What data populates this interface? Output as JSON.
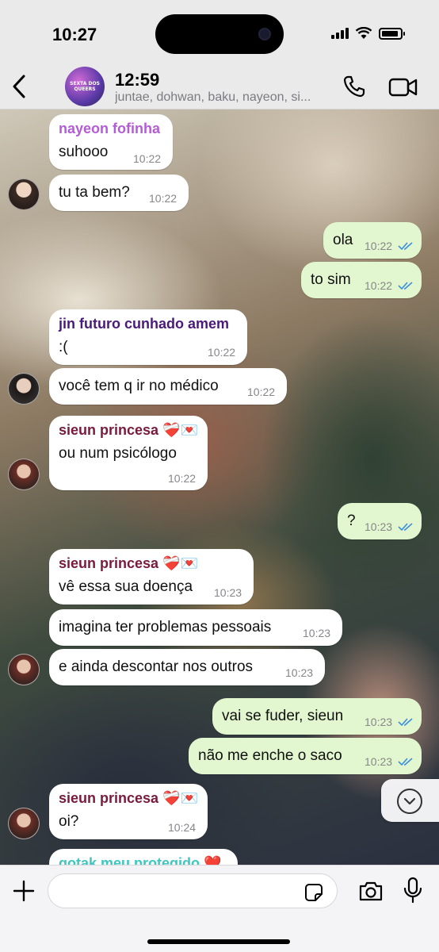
{
  "status_bar": {
    "time": "10:27",
    "battery_level": 0.9
  },
  "header": {
    "avatar_text": "SEXTA DOS QUEERS",
    "title": "12:59",
    "subtitle": "juntae, dohwan, baku, nayeon, si..."
  },
  "colors": {
    "incoming": "#ffffff",
    "outgoing": "#e2f6cf",
    "read_ticks": "#3b8fe0",
    "nayeon": "#b45cd8",
    "jin": "#4a1a7a",
    "sieun": "#7a1a3c",
    "gotak": "#3ec6c0"
  },
  "messages": [
    {
      "dir": "in",
      "sender": "nayeon fofinha",
      "text": "suhooo",
      "time": "10:22"
    },
    {
      "dir": "in",
      "text": "tu ta bem?",
      "time": "10:22"
    },
    {
      "dir": "out",
      "text": "ola",
      "time": "10:22"
    },
    {
      "dir": "out",
      "text": "to sim",
      "time": "10:22"
    },
    {
      "dir": "in",
      "sender": "jin futuro cunhado amem",
      "text": ":(",
      "time": "10:22"
    },
    {
      "dir": "in",
      "text": "você tem q ir no médico",
      "time": "10:22"
    },
    {
      "dir": "in",
      "sender": "sieun princesa ❤️‍🩹💌",
      "text": "ou num psicólogo",
      "time": "10:22"
    },
    {
      "dir": "out",
      "text": "?",
      "time": "10:23"
    },
    {
      "dir": "in",
      "sender": "sieun princesa ❤️‍🩹💌",
      "text": "vê essa sua doença",
      "time": "10:23"
    },
    {
      "dir": "in",
      "text": "imagina ter problemas pessoais",
      "time": "10:23"
    },
    {
      "dir": "in",
      "text": "e ainda descontar nos outros",
      "time": "10:23"
    },
    {
      "dir": "out",
      "text": "vai se fuder, sieun",
      "time": "10:23"
    },
    {
      "dir": "out",
      "text": "não me enche o saco",
      "time": "10:23"
    },
    {
      "dir": "in",
      "sender": "sieun princesa ❤️‍🩹💌",
      "text": "oi?",
      "time": "10:24"
    },
    {
      "dir": "in",
      "sender": "gotak meu protegido ❤️",
      "text": "",
      "time": ""
    }
  ],
  "composer": {
    "placeholder": "",
    "value": ""
  },
  "icons": [
    "back-chevron-icon",
    "phone-icon",
    "video-icon",
    "plus-icon",
    "sticker-icon",
    "camera-icon",
    "mic-icon",
    "chevron-down-icon"
  ]
}
